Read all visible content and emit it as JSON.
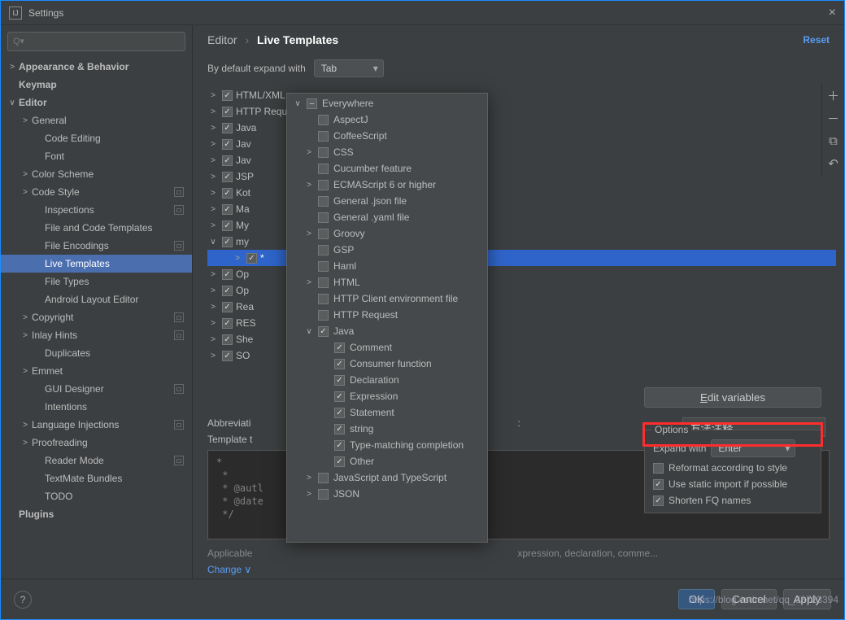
{
  "window": {
    "title": "Settings"
  },
  "search": {
    "placeholder": "Q▾"
  },
  "sidebar": {
    "items": [
      {
        "label": "Appearance & Behavior",
        "arrow": ">",
        "bold": true,
        "indent": 0
      },
      {
        "label": "Keymap",
        "arrow": "",
        "bold": true,
        "indent": 0
      },
      {
        "label": "Editor",
        "arrow": "∨",
        "bold": true,
        "indent": 0
      },
      {
        "label": "General",
        "arrow": ">",
        "indent": 1
      },
      {
        "label": "Code Editing",
        "arrow": "",
        "indent": 2
      },
      {
        "label": "Font",
        "arrow": "",
        "indent": 2
      },
      {
        "label": "Color Scheme",
        "arrow": ">",
        "indent": 1
      },
      {
        "label": "Code Style",
        "arrow": ">",
        "indent": 1,
        "mod": true
      },
      {
        "label": "Inspections",
        "arrow": "",
        "indent": 2,
        "mod": true
      },
      {
        "label": "File and Code Templates",
        "arrow": "",
        "indent": 2
      },
      {
        "label": "File Encodings",
        "arrow": "",
        "indent": 2,
        "mod": true
      },
      {
        "label": "Live Templates",
        "arrow": "",
        "indent": 2,
        "selected": true
      },
      {
        "label": "File Types",
        "arrow": "",
        "indent": 2
      },
      {
        "label": "Android Layout Editor",
        "arrow": "",
        "indent": 2
      },
      {
        "label": "Copyright",
        "arrow": ">",
        "indent": 1,
        "mod": true
      },
      {
        "label": "Inlay Hints",
        "arrow": ">",
        "indent": 1,
        "mod": true
      },
      {
        "label": "Duplicates",
        "arrow": "",
        "indent": 2
      },
      {
        "label": "Emmet",
        "arrow": ">",
        "indent": 1
      },
      {
        "label": "GUI Designer",
        "arrow": "",
        "indent": 2,
        "mod": true
      },
      {
        "label": "Intentions",
        "arrow": "",
        "indent": 2
      },
      {
        "label": "Language Injections",
        "arrow": ">",
        "indent": 1,
        "mod": true
      },
      {
        "label": "Proofreading",
        "arrow": ">",
        "indent": 1
      },
      {
        "label": "Reader Mode",
        "arrow": "",
        "indent": 2,
        "mod": true
      },
      {
        "label": "TextMate Bundles",
        "arrow": "",
        "indent": 2
      },
      {
        "label": "TODO",
        "arrow": "",
        "indent": 2
      },
      {
        "label": "Plugins",
        "arrow": "",
        "bold": true,
        "indent": 0
      }
    ]
  },
  "breadcrumb": {
    "a": "Editor",
    "b": "Live Templates"
  },
  "reset_label": "Reset",
  "default_expand": {
    "label": "By default expand with",
    "value": "Tab"
  },
  "templates": [
    {
      "label": "HTML/XML",
      "checked": true
    },
    {
      "label": "HTTP Request",
      "checked": true
    },
    {
      "label": "Java",
      "checked": true
    },
    {
      "label": "Jav",
      "checked": true
    },
    {
      "label": "Jav",
      "checked": true
    },
    {
      "label": "JSP",
      "checked": true
    },
    {
      "label": "Kot",
      "checked": true
    },
    {
      "label": "Ma",
      "checked": true
    },
    {
      "label": "My",
      "checked": true
    },
    {
      "label": "my",
      "checked": true,
      "open": true
    },
    {
      "label": "*",
      "checked": true,
      "child": true,
      "hl": true
    },
    {
      "label": "Op",
      "checked": true
    },
    {
      "label": "Op",
      "checked": true
    },
    {
      "label": "Rea",
      "checked": true
    },
    {
      "label": "RES",
      "checked": true
    },
    {
      "label": "She",
      "checked": true
    },
    {
      "label": "SO",
      "checked": true
    }
  ],
  "popup": [
    {
      "label": "Everywhere",
      "arrow": "∨",
      "state": "minus",
      "indent": 0
    },
    {
      "label": "AspectJ",
      "indent": 1
    },
    {
      "label": "CoffeeScript",
      "indent": 1
    },
    {
      "label": "CSS",
      "arrow": ">",
      "indent": 1
    },
    {
      "label": "Cucumber feature",
      "indent": 1
    },
    {
      "label": "ECMAScript 6 or higher",
      "arrow": ">",
      "indent": 1
    },
    {
      "label": "General .json file",
      "indent": 1
    },
    {
      "label": "General .yaml file",
      "indent": 1
    },
    {
      "label": "Groovy",
      "arrow": ">",
      "indent": 1
    },
    {
      "label": "GSP",
      "indent": 1
    },
    {
      "label": "Haml",
      "indent": 1
    },
    {
      "label": "HTML",
      "arrow": ">",
      "indent": 1
    },
    {
      "label": "HTTP Client environment file",
      "indent": 1
    },
    {
      "label": "HTTP Request",
      "indent": 1
    },
    {
      "label": "Java",
      "arrow": "∨",
      "state": "checked",
      "indent": 1,
      "redbox": true
    },
    {
      "label": "Comment",
      "state": "checked",
      "indent": 2
    },
    {
      "label": "Consumer function",
      "state": "checked",
      "indent": 2
    },
    {
      "label": "Declaration",
      "state": "checked",
      "indent": 2
    },
    {
      "label": "Expression",
      "state": "checked",
      "indent": 2
    },
    {
      "label": "Statement",
      "state": "checked",
      "indent": 2
    },
    {
      "label": "string",
      "state": "checked",
      "indent": 2
    },
    {
      "label": "Type-matching completion",
      "state": "checked",
      "indent": 2
    },
    {
      "label": "Other",
      "state": "checked",
      "indent": 2
    },
    {
      "label": "JavaScript and TypeScript",
      "arrow": ">",
      "indent": 1
    },
    {
      "label": "JSON",
      "arrow": ">",
      "indent": 1
    }
  ],
  "abbrev": {
    "label": "Abbreviati",
    "desc_label": ":",
    "desc_value": "方法注释"
  },
  "template_text": {
    "label": "Template t",
    "body": "*\n *\n * @autl\n * @date\n */"
  },
  "edit_vars": "Edit variables",
  "options": {
    "legend": "Options",
    "expand_label": "Expand with",
    "expand_value": "Enter",
    "reformat": "Reformat according to style",
    "static_import": "Use static import if possible",
    "static_import_checked": true,
    "shorten": "Shorten FQ names",
    "shorten_checked": true
  },
  "applicable": {
    "prefix": "Applicable",
    "context": "xpression, declaration, comme...",
    "change": "Change ∨"
  },
  "buttons": {
    "ok": "OK",
    "cancel": "Cancel",
    "apply": "Apply"
  },
  "watermark": "https://blog.csdn.net/qq_38723394"
}
